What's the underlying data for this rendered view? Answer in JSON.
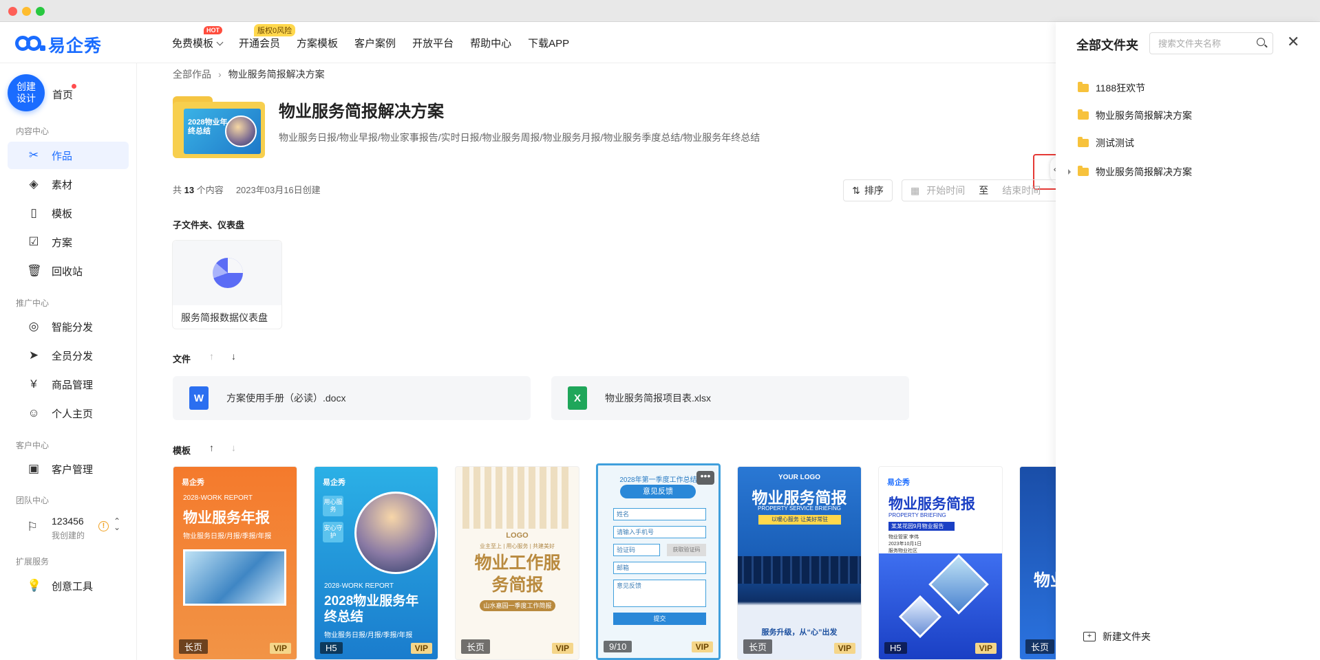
{
  "window": {
    "controls": [
      "close",
      "minimize",
      "maximize"
    ]
  },
  "header": {
    "logo_text": "易企秀",
    "nav": [
      {
        "label": "免费模板",
        "badge": "HOT",
        "has_dropdown": true
      },
      {
        "label": "开通会员",
        "badge": "版权0风险"
      },
      {
        "label": "方案模板"
      },
      {
        "label": "客户案例"
      },
      {
        "label": "开放平台"
      },
      {
        "label": "帮助中心"
      },
      {
        "label": "下载APP"
      }
    ]
  },
  "sidebar": {
    "create_label": "创建设计",
    "home_label": "首页",
    "sections": {
      "content": "内容中心",
      "promotion": "推广中心",
      "customer": "客户中心",
      "team": "团队中心",
      "extension": "扩展服务"
    },
    "content_items": [
      "作品",
      "素材",
      "模板",
      "方案",
      "回收站"
    ],
    "promotion_items": [
      "智能分发",
      "全员分发",
      "商品管理",
      "个人主页"
    ],
    "customer_items": [
      "客户管理"
    ],
    "team": {
      "name": "123456",
      "sub": "我创建的"
    },
    "extension_items": [
      "创意工具"
    ]
  },
  "main": {
    "breadcrumb": [
      "全部作品",
      "物业服务简报解决方案"
    ],
    "title": "物业服务简报解决方案",
    "tags": "物业服务日报/物业早报/物业家事报告/实时日报/物业服务周报/物业服务月报/物业服务季度总结/物业服务年终总结",
    "folder_cover_text": "2028物业年终总结",
    "meta": {
      "prefix": "共",
      "count": "13",
      "suffix": "个内容",
      "created": "2023年03月16日创建"
    },
    "sort_label": "排序",
    "date_start_placeholder": "开始时间",
    "date_to": "至",
    "date_end_placeholder": "结束时间",
    "subfolders_title": "子文件夹、仪表盘",
    "dashboard_label": "服务简报数据仪表盘",
    "files_title": "文件",
    "files": [
      {
        "name": "方案使用手册（必读）.docx",
        "icon": "W",
        "color": "#2b6ff0"
      },
      {
        "name": "物业服务简报项目表.xlsx",
        "icon": "X",
        "color": "#1fa65a"
      }
    ],
    "templates_title": "模板",
    "templates": [
      {
        "tag": "长页",
        "vip": "VIP",
        "brand": "易企秀",
        "sub": "2028-WORK REPORT",
        "title": "物业服务年报",
        "desc": "物业服务日报/月报/季报/年报"
      },
      {
        "tag": "H5",
        "vip": "VIP",
        "brand": "易企秀",
        "chips": [
          "用心服务",
          "安心守护"
        ],
        "sub": "2028-WORK REPORT",
        "title": "2028物业服务年终总结",
        "desc": "物业服务日报/月报/季报/年报"
      },
      {
        "tag": "长页",
        "vip": "VIP",
        "logo": "LOGO",
        "motto": "业主至上 | 用心服务 | 共建美好",
        "title": "物业工作服务简报",
        "sub": "山水嘉园一季度工作简报"
      },
      {
        "tag": "9/10",
        "vip": "VIP",
        "header": "2028年第一季度工作总结",
        "form_title": "意见反馈",
        "fields": [
          "姓名",
          "请输入手机号",
          "验证码",
          "邮箱",
          "意见反馈"
        ],
        "code_btn": "获取验证码",
        "submit": "提交",
        "more": "•••"
      },
      {
        "tag": "长页",
        "vip": "VIP",
        "logo": "YOUR LOGO",
        "title": "物业服务简报",
        "en": "PROPERTY SERVICE BRIEFING",
        "band": "以暖心服务 让美好常驻",
        "slogan": "服务升级，从“心”出发"
      },
      {
        "tag": "H5",
        "vip": "VIP",
        "brand": "易企秀",
        "title": "物业服务简报",
        "en": "PROPERTY BRIEFING",
        "band": "某某花园9月物业报告",
        "meta": "物业管家 李伟\n2023年10月1日\n服务物业社区"
      },
      {
        "tag": "长页",
        "vip": "VIP",
        "title": "物业"
      }
    ]
  },
  "panel": {
    "title": "全部文件夹",
    "search_placeholder": "搜索文件夹名称",
    "folders": [
      {
        "name": "1188狂欢节",
        "expandable": false
      },
      {
        "name": "物业服务简报解决方案",
        "expandable": false
      },
      {
        "name": "测试测试",
        "expandable": false
      },
      {
        "name": "物业服务简报解决方案",
        "expandable": true
      }
    ],
    "new_folder_label": "新建文件夹"
  },
  "colors": {
    "brand": "#1a6cff",
    "highlight_box": "#e53935"
  }
}
